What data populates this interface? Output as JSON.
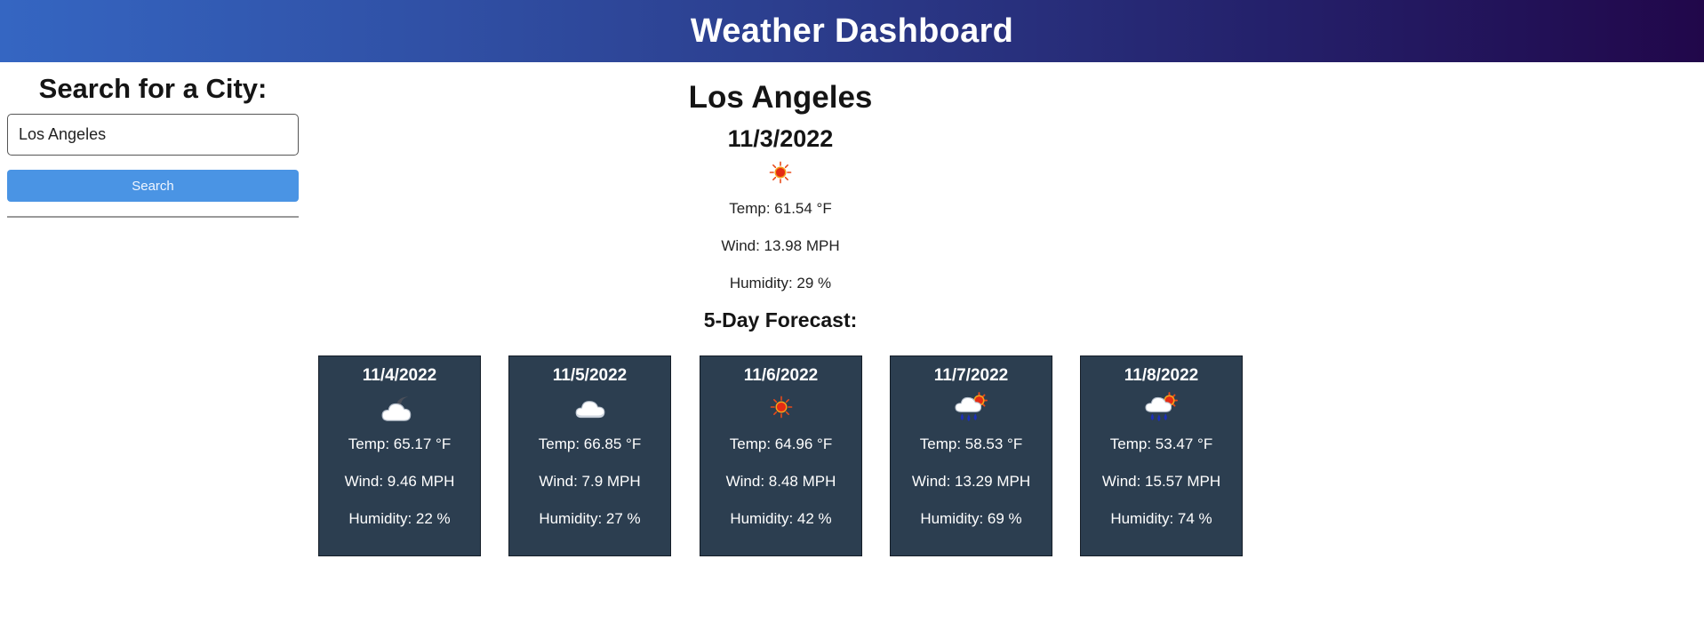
{
  "header": {
    "title": "Weather Dashboard"
  },
  "sidebar": {
    "heading": "Search for a City:",
    "search_value": "Los Angeles",
    "search_button_label": "Search"
  },
  "current": {
    "city": "Los Angeles",
    "date": "11/3/2022",
    "icon": "sun-icon",
    "temp": "Temp: 61.54 °F",
    "wind": "Wind: 13.98 MPH",
    "humidity": "Humidity: 29 %"
  },
  "forecast": {
    "title": "5-Day Forecast:",
    "days": [
      {
        "date": "11/4/2022",
        "icon": "partly-cloudy-night-icon",
        "temp": "Temp: 65.17 °F",
        "wind": "Wind: 9.46 MPH",
        "humidity": "Humidity: 22 %"
      },
      {
        "date": "11/5/2022",
        "icon": "cloud-icon",
        "temp": "Temp: 66.85 °F",
        "wind": "Wind: 7.9 MPH",
        "humidity": "Humidity: 27 %"
      },
      {
        "date": "11/6/2022",
        "icon": "sun-icon",
        "temp": "Temp: 64.96 °F",
        "wind": "Wind: 8.48 MPH",
        "humidity": "Humidity: 42 %"
      },
      {
        "date": "11/7/2022",
        "icon": "rain-sun-icon",
        "temp": "Temp: 58.53 °F",
        "wind": "Wind: 13.29 MPH",
        "humidity": "Humidity: 69 %"
      },
      {
        "date": "11/8/2022",
        "icon": "rain-sun-icon",
        "temp": "Temp: 53.47 °F",
        "wind": "Wind: 15.57 MPH",
        "humidity": "Humidity: 74 %"
      }
    ]
  },
  "colors": {
    "header_gradient_start": "#3566c2",
    "header_gradient_end": "#21074a",
    "search_button": "#4a94e4",
    "card_background": "#2c3e50"
  }
}
